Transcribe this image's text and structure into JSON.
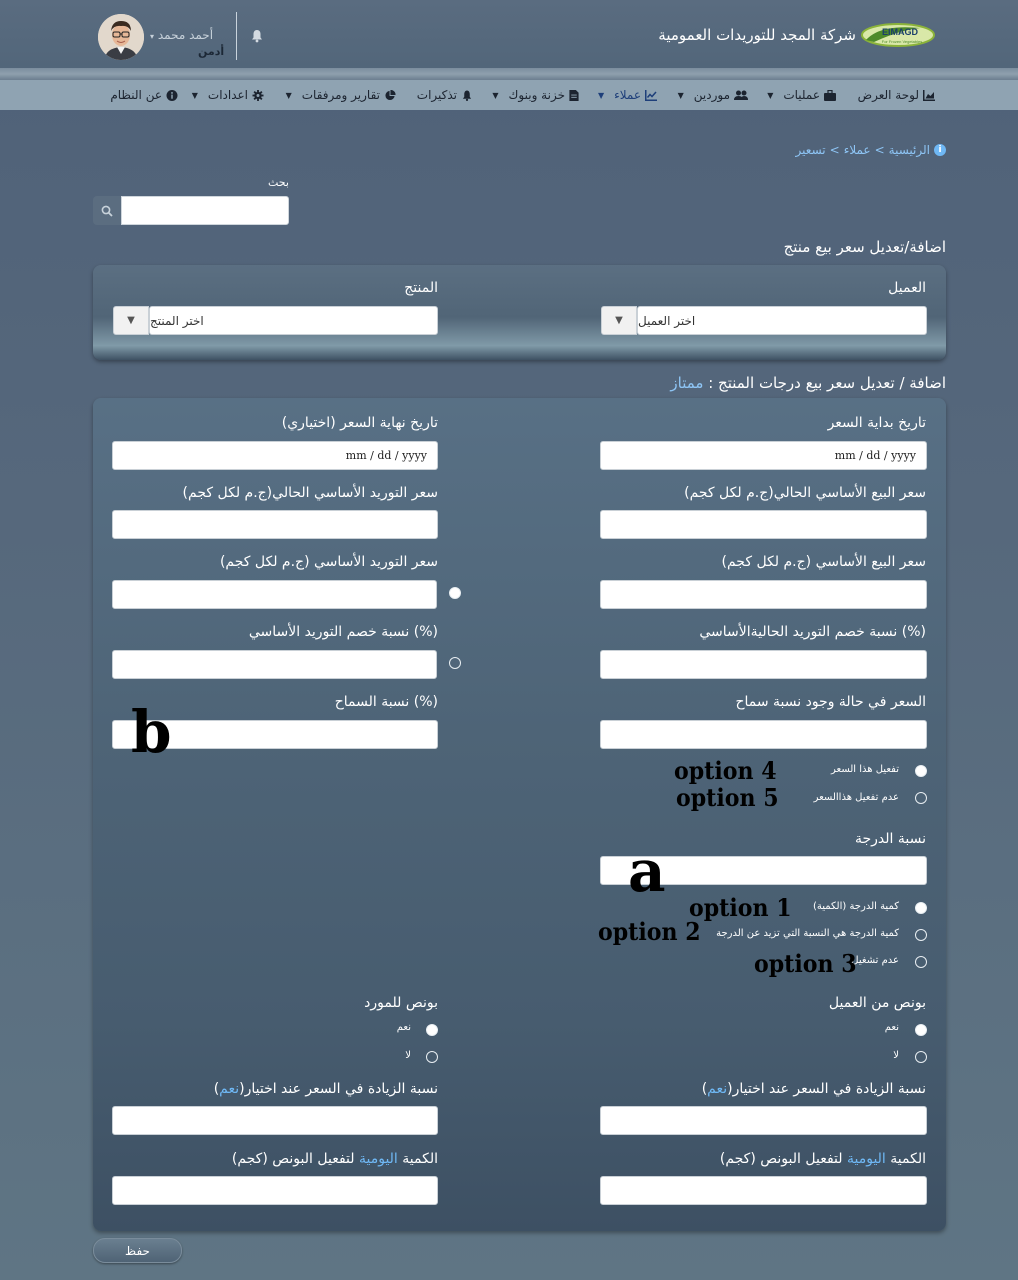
{
  "header": {
    "company_name": "شركة المجد للتوريدات العمومية",
    "logo_text": "ElMAGD",
    "logo_sub": "For Frozen Vegetables",
    "user_name": "أحمد محمد",
    "user_role": "أدمن"
  },
  "nav": {
    "items": [
      {
        "label": "لوحة العرض",
        "icon": "chart-area-icon",
        "dropdown": false
      },
      {
        "label": "عمليات",
        "icon": "briefcase-icon",
        "dropdown": true
      },
      {
        "label": "موردين",
        "icon": "users-icon",
        "dropdown": true
      },
      {
        "label": "عملاء",
        "icon": "chart-line-icon",
        "dropdown": true,
        "active": true
      },
      {
        "label": "خزنة وبنوك",
        "icon": "file-invoice-icon",
        "dropdown": true
      },
      {
        "label": "تذكيرات",
        "icon": "bell-icon",
        "dropdown": false
      },
      {
        "label": "تقارير ومرفقات",
        "icon": "chart-pie-icon",
        "dropdown": true
      },
      {
        "label": "اعدادات",
        "icon": "gear-icon",
        "dropdown": true
      },
      {
        "label": "عن النظام",
        "icon": "info-icon",
        "dropdown": false
      }
    ]
  },
  "breadcrumb": {
    "home": "الرئيسية",
    "sep1": ">",
    "clients": "عملاء",
    "sep2": ">",
    "current": "تسعير"
  },
  "search": {
    "label": "بحث",
    "value": ""
  },
  "section1": {
    "title": "اضافة/تعديل سعر بيع منتج",
    "client_label": "العميل",
    "client_placeholder": "اختر العميل",
    "product_label": "المنتج",
    "product_placeholder": "اختر المنتج"
  },
  "section2": {
    "title_prefix": "اضافة / تعديل سعر بيع درجات المنتج :",
    "title_grade": "ممتاز",
    "start_date_label": "تاريخ بداية السعر",
    "start_date_value": "mm / dd / yyyy",
    "end_date_label": "تاريخ نهاية السعر (اختياري)",
    "end_date_value": "mm / dd / yyyy",
    "current_sale_price_label": "سعر البيع الأساسي الحالي(ج.م لكل كجم)",
    "current_supply_price_label": "سعر التوريد الأساسي الحالي(ج.م لكل كجم)",
    "base_sale_price_label": "سعر البيع الأساسي (ج.م لكل كجم)",
    "base_supply_price_label": "سعر التوريد الأساسي (ج.م لكل كجم)",
    "current_supply_discount_label": "(%) نسبة خصم التوريد الحاليةالأساسي",
    "supply_discount_label": "(%) نسبة خصم التوريد الأساسي",
    "tolerance_price_label": "السعر في حالة وجود نسبة سماح",
    "tolerance_pct_label": "(%) نسبة السماح",
    "activate_price_label": "تفعيل هذا السعر",
    "deactivate_price_label": "عدم تفعيل هذاالسعر",
    "grade_pct_label": "نسبة الدرجة",
    "grade_qty_label": "كمية الدرجة (الكمية)",
    "grade_qty_exceed_label": "كمية الدرجة هي النسبة التي تزيد عن الدرجة",
    "no_operation_label": "عدم تشغيل",
    "client_bonus_label": "بونص من العميل",
    "supplier_bonus_label": "بونص للمورد",
    "yes_label": "نعم",
    "no_label": "لا",
    "increase_pct_label_prefix": "نسبة الزيادة في السعر عند اختيار(",
    "increase_pct_label_hl": "نعم",
    "increase_pct_label_suffix": ")",
    "daily_qty_prefix": "الكمية",
    "daily_qty_hl": "اليومية",
    "daily_qty_suffix": "لتفعيل البونص (كجم)"
  },
  "annotations": {
    "a": "a",
    "b": "b",
    "option1": "option 1",
    "option2": "option 2",
    "option3": "option 3",
    "option4": "option 4",
    "option5": "option 5"
  },
  "save_label": "حفظ",
  "colors": {
    "accent": "#6fb8f5",
    "background": "#52667a",
    "panel": "#4e6274"
  }
}
